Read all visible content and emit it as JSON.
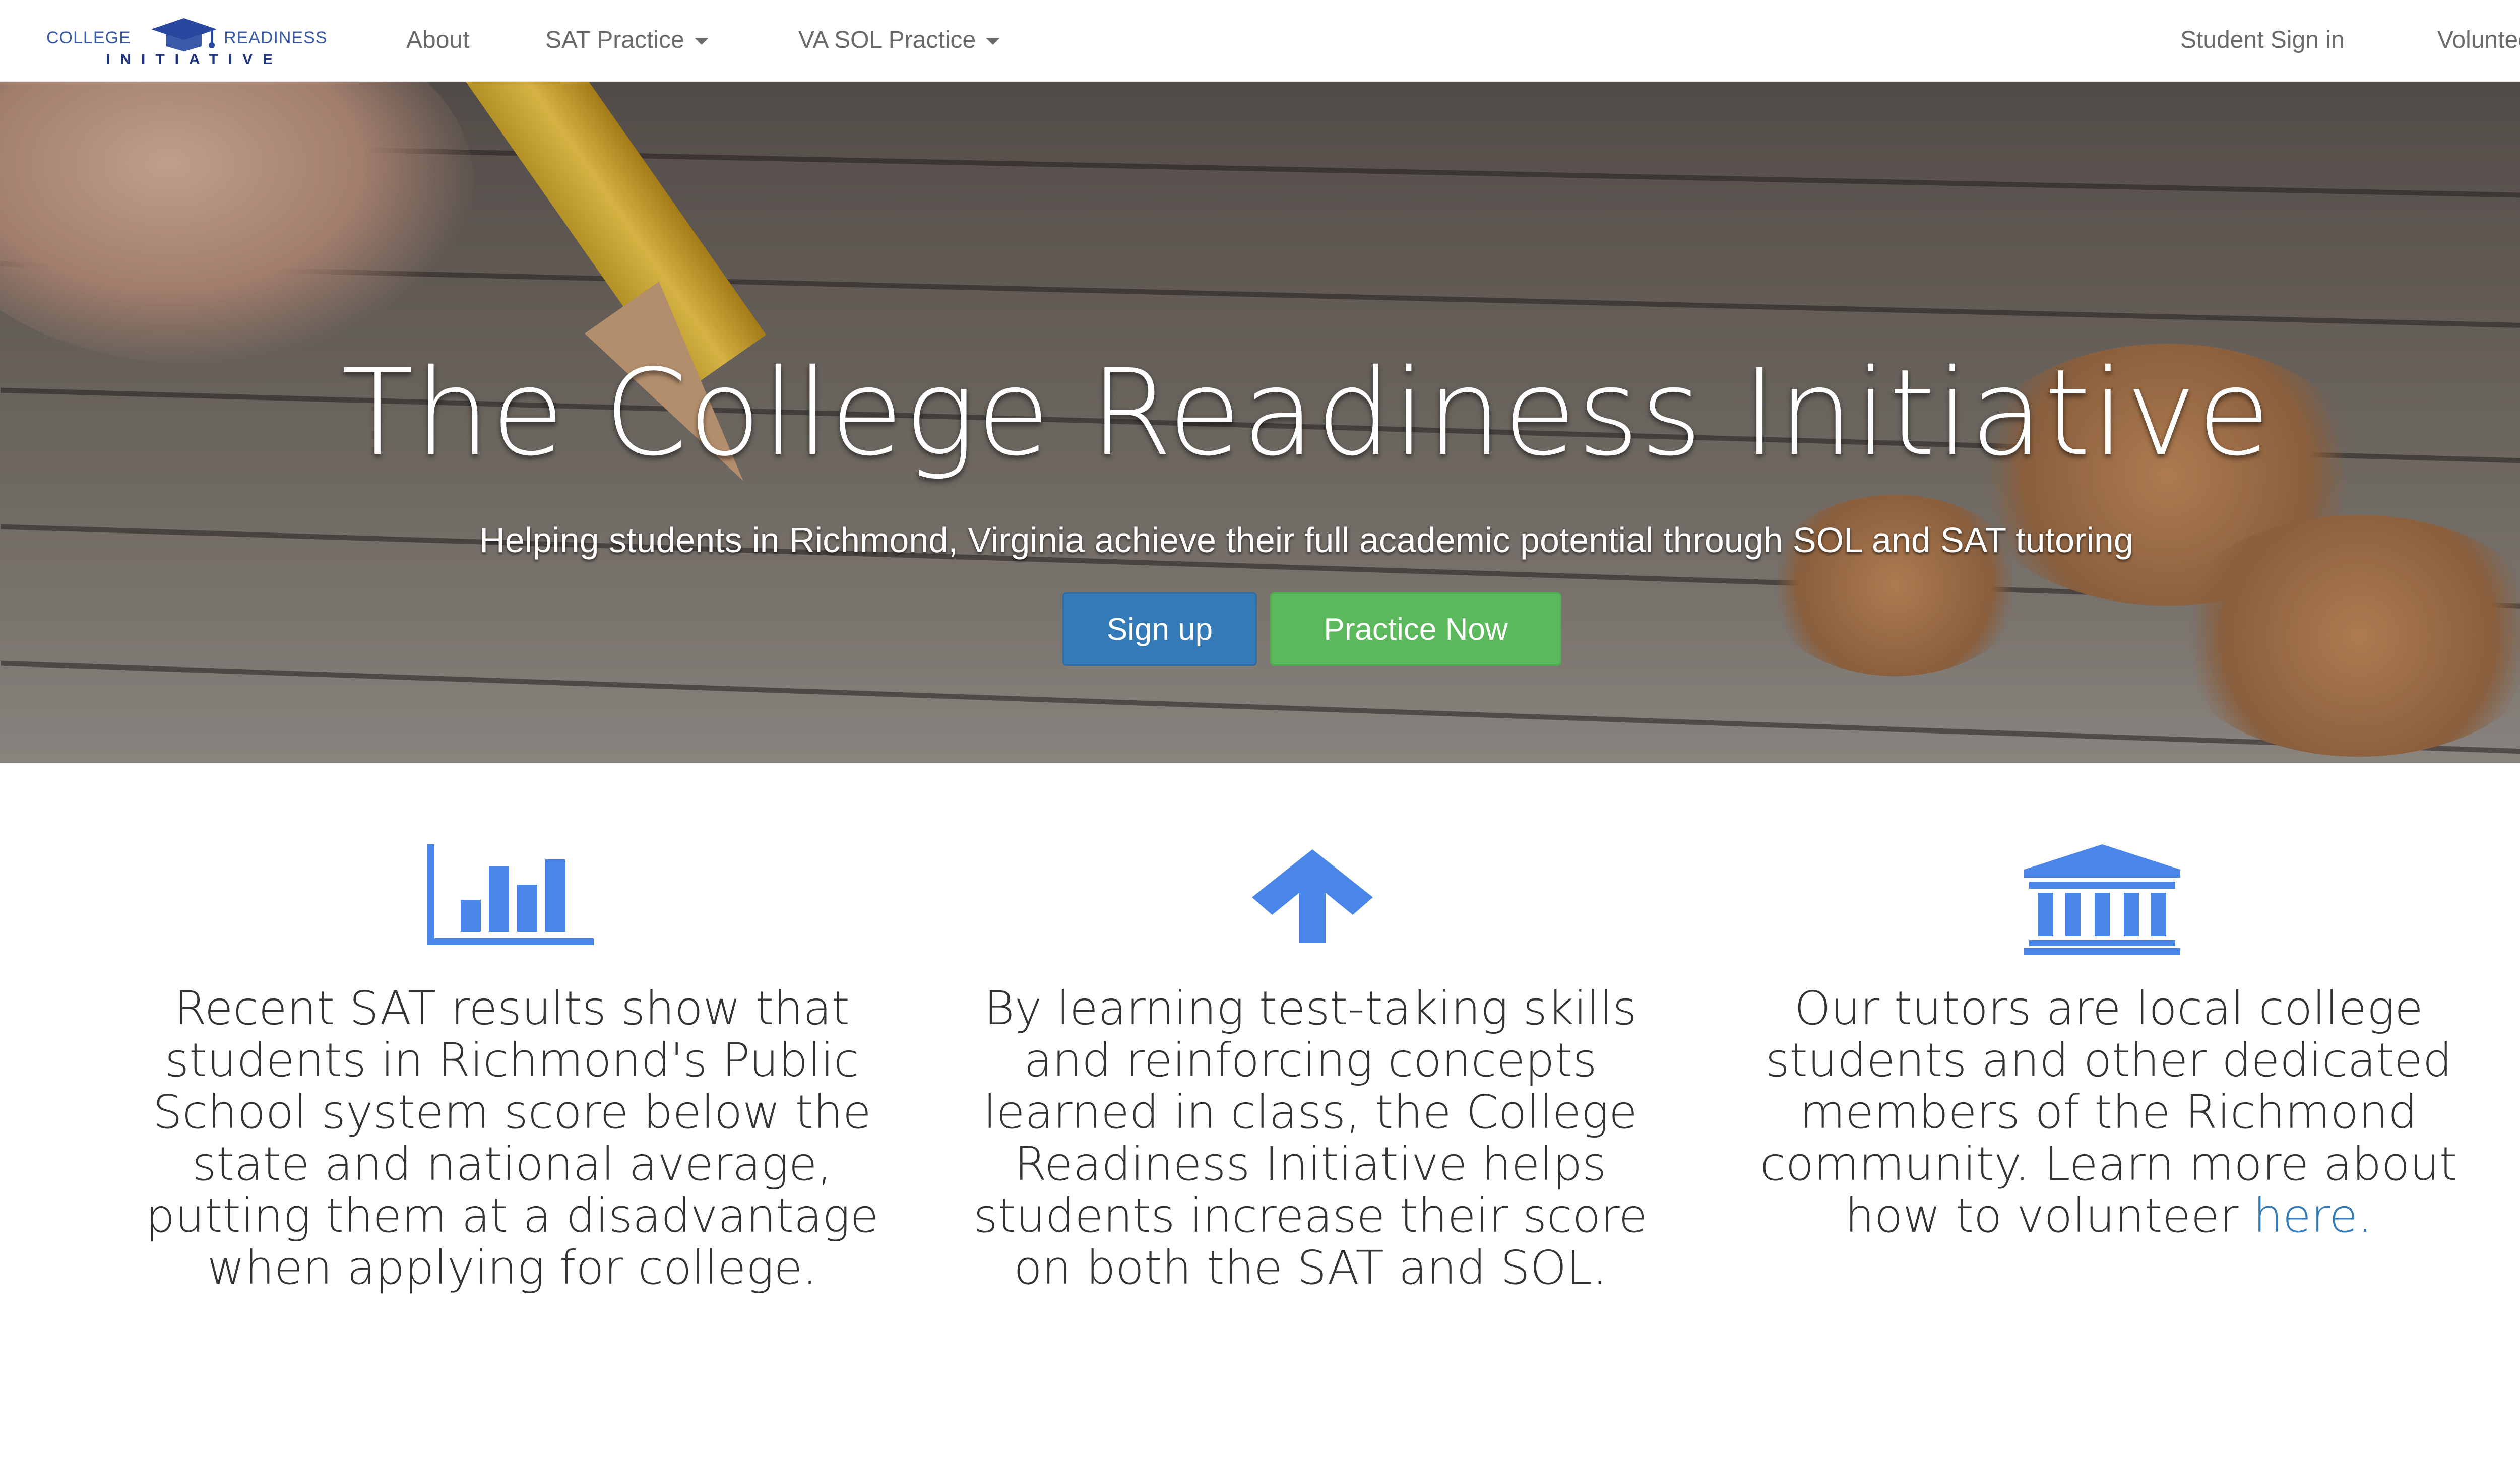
{
  "brand": {
    "left_word": "COLLEGE",
    "right_word": "READINESS",
    "sub_word": "INITIATIVE",
    "icon": "graduation-cap-icon"
  },
  "nav": {
    "about": "About",
    "sat_practice": "SAT Practice",
    "va_sol_practice": "VA SOL Practice",
    "student_sign_in": "Student Sign in",
    "volunteer": "Volunteer"
  },
  "hero": {
    "title": "The College Readiness Initiative",
    "subtitle": "Helping students in Richmond, Virginia achieve their full academic potential through SOL and SAT tutoring",
    "signup_label": "Sign up",
    "practice_label": "Practice Now"
  },
  "features": [
    {
      "icon": "bar-chart-icon",
      "text": "Recent SAT results show that students in Richmond's Public School system score below the state and national average, putting them at a disadvantage when applying for college."
    },
    {
      "icon": "arrow-up-icon",
      "text": "By learning test-taking skills and reinforcing concepts learned in class, the College Readiness Initiative helps students increase their score on both the SAT and SOL."
    },
    {
      "icon": "institution-icon",
      "text": "Our tutors are local college students and other dedicated members of the Richmond community. Learn more about how to volunteer ",
      "link_text": "here."
    }
  ],
  "colors": {
    "link": "#337ab7",
    "primary": "#337ab7",
    "success": "#5cb85c",
    "icon_blue": "#4a86e8",
    "brand_blue": "#3a5aa8"
  }
}
